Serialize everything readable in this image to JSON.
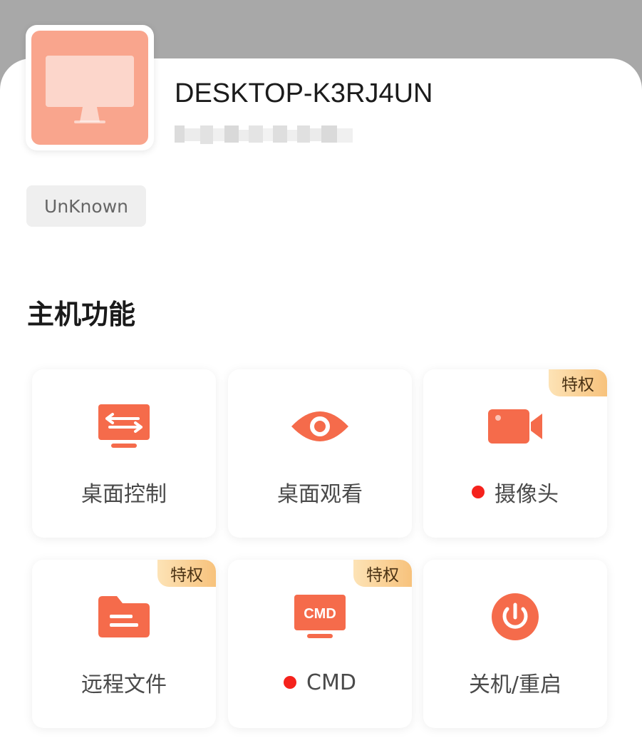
{
  "device": {
    "name": "DESKTOP-K3RJ4UN",
    "tag": "UnKnown"
  },
  "colors": {
    "accent": "#f56b4b",
    "accent_light": "#f9a58d",
    "badge_gradient_start": "#fde3b6",
    "badge_gradient_end": "#f7c27c",
    "status_dot": "#f5221c"
  },
  "section": {
    "title": "主机功能"
  },
  "features": [
    {
      "label": "桌面控制",
      "icon": "desktop-control-icon",
      "badge": "",
      "status_dot": false
    },
    {
      "label": "桌面观看",
      "icon": "eye-icon",
      "badge": "",
      "status_dot": false
    },
    {
      "label": "摄像头",
      "icon": "camera-icon",
      "badge": "特权",
      "status_dot": true
    },
    {
      "label": "远程文件",
      "icon": "folder-icon",
      "badge": "特权",
      "status_dot": false
    },
    {
      "label": "CMD",
      "icon": "cmd-icon",
      "badge": "特权",
      "status_dot": true
    },
    {
      "label": "关机/重启",
      "icon": "power-icon",
      "badge": "",
      "status_dot": false
    }
  ]
}
